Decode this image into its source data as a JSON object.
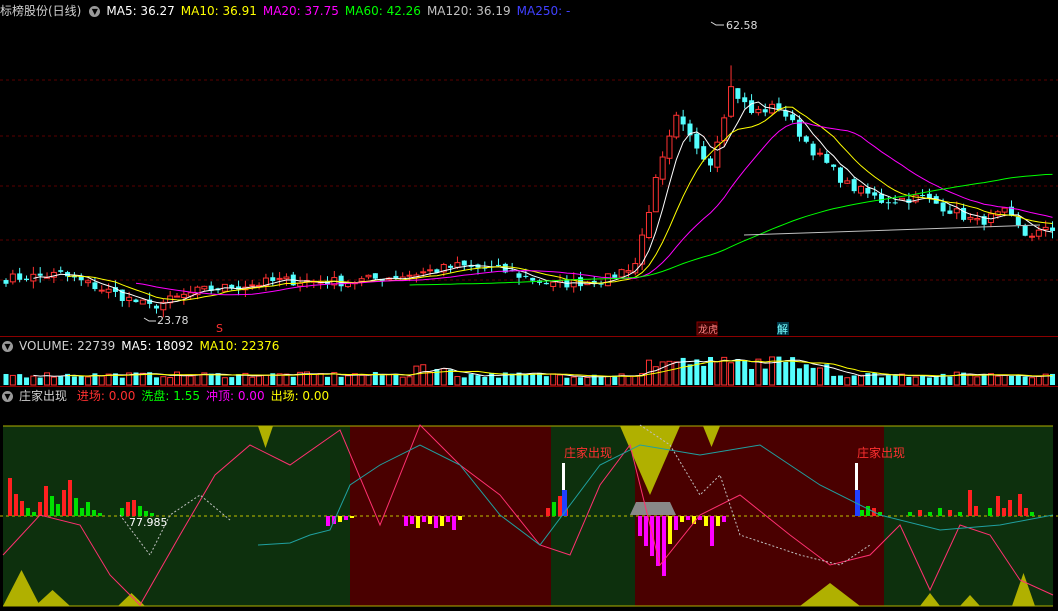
{
  "price_header": {
    "title": "标榜股份(日线)",
    "items": [
      {
        "label": "MA5: 36.27",
        "color": "#ffffff"
      },
      {
        "label": "MA10: 36.91",
        "color": "#ffff00"
      },
      {
        "label": "MA20: 37.75",
        "color": "#ff00ff"
      },
      {
        "label": "MA60: 42.26",
        "color": "#00ff00"
      },
      {
        "label": "MA120: 36.19",
        "color": "#c0c0c0"
      },
      {
        "label": "MA250: -",
        "color": "#4040ff"
      }
    ]
  },
  "volume_header": {
    "items": [
      {
        "label": "VOLUME: 22739",
        "color": "#d0d0d0"
      },
      {
        "label": "MA5: 18092",
        "color": "#ffffff"
      },
      {
        "label": "MA10: 22376",
        "color": "#ffff00"
      }
    ]
  },
  "indicator_header": {
    "title": "庄家出现",
    "items": [
      {
        "label": "进场: 0.00",
        "color": "#ff3030"
      },
      {
        "label": "洗盘: 1.55",
        "color": "#00ff00"
      },
      {
        "label": "冲顶: 0.00",
        "color": "#ff00ff"
      },
      {
        "label": "出场: 0.00",
        "color": "#ffff00"
      }
    ]
  },
  "annotations": {
    "high": "62.58",
    "low": "23.78",
    "marker_s": "S",
    "marker_longhu": "龙虎",
    "marker_jie": "解",
    "ind_value": "77.985",
    "signal_1": "庄家出现",
    "signal_2": "庄家出现"
  },
  "chart_data": {
    "type": "candlestick",
    "price_range": [
      20,
      66
    ],
    "high_marker": 62.58,
    "low_marker": 23.78,
    "anchors": [
      {
        "i": 0,
        "p": 28.5
      },
      {
        "i": 8,
        "p": 29.2
      },
      {
        "i": 15,
        "p": 26.5
      },
      {
        "i": 21,
        "p": 24.0
      },
      {
        "i": 28,
        "p": 26.5
      },
      {
        "i": 40,
        "p": 28.2
      },
      {
        "i": 50,
        "p": 28.0
      },
      {
        "i": 58,
        "p": 29.0
      },
      {
        "i": 66,
        "p": 30.5
      },
      {
        "i": 72,
        "p": 30.0
      },
      {
        "i": 80,
        "p": 27.5
      },
      {
        "i": 88,
        "p": 28.5
      },
      {
        "i": 92,
        "p": 31.0
      },
      {
        "i": 95,
        "p": 44.0
      },
      {
        "i": 98,
        "p": 54.0
      },
      {
        "i": 100,
        "p": 51.0
      },
      {
        "i": 103,
        "p": 47.0
      },
      {
        "i": 106,
        "p": 59.0
      },
      {
        "i": 109,
        "p": 55.0
      },
      {
        "i": 113,
        "p": 56.0
      },
      {
        "i": 118,
        "p": 49.0
      },
      {
        "i": 123,
        "p": 43.5
      },
      {
        "i": 128,
        "p": 41.0
      },
      {
        "i": 134,
        "p": 41.5
      },
      {
        "i": 138,
        "p": 39.5
      },
      {
        "i": 142,
        "p": 37.5
      },
      {
        "i": 146,
        "p": 39.0
      },
      {
        "i": 149,
        "p": 35.5
      },
      {
        "i": 153,
        "p": 36.3
      }
    ]
  }
}
